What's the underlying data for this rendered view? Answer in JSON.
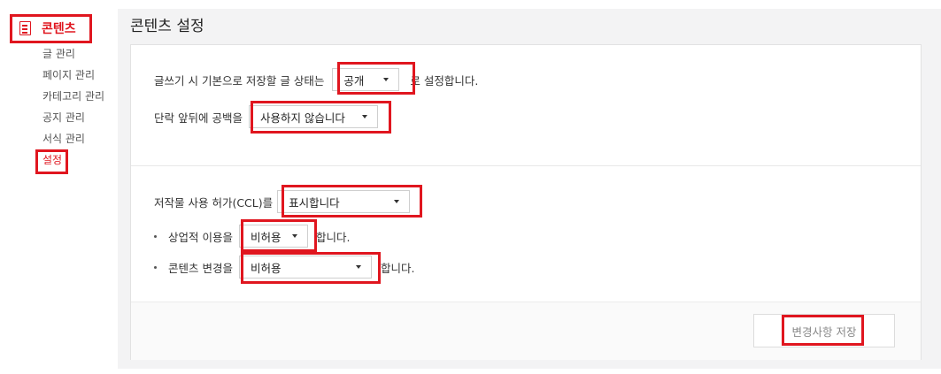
{
  "sidebar": {
    "section_label": "콘텐츠",
    "items": [
      {
        "label": "글 관리"
      },
      {
        "label": "페이지 관리"
      },
      {
        "label": "카테고리 관리"
      },
      {
        "label": "공지 관리"
      },
      {
        "label": "서식 관리"
      },
      {
        "label": "설정"
      }
    ]
  },
  "main": {
    "title": "콘텐츠 설정",
    "default_state": {
      "prefix": "글쓰기 시 기본으로 저장할 글 상태는",
      "value": "공개",
      "suffix": "로 설정합니다."
    },
    "word_spacing": {
      "prefix": "단락 앞뒤에 공백을",
      "value": "사용하지 않습니다"
    },
    "ccl": {
      "prefix": "저작물 사용 허가(CCL)를",
      "value": "표시합니다"
    },
    "commercial": {
      "prefix": "상업적 이용을",
      "value": "비허용",
      "suffix": "합니다."
    },
    "modification": {
      "prefix": "콘텐츠 변경을",
      "value": "비허용",
      "suffix": "합니다."
    },
    "save_label": "변경사항 저장"
  },
  "colors": {
    "accent": "#e0161f",
    "background": "#f3f3f4"
  }
}
